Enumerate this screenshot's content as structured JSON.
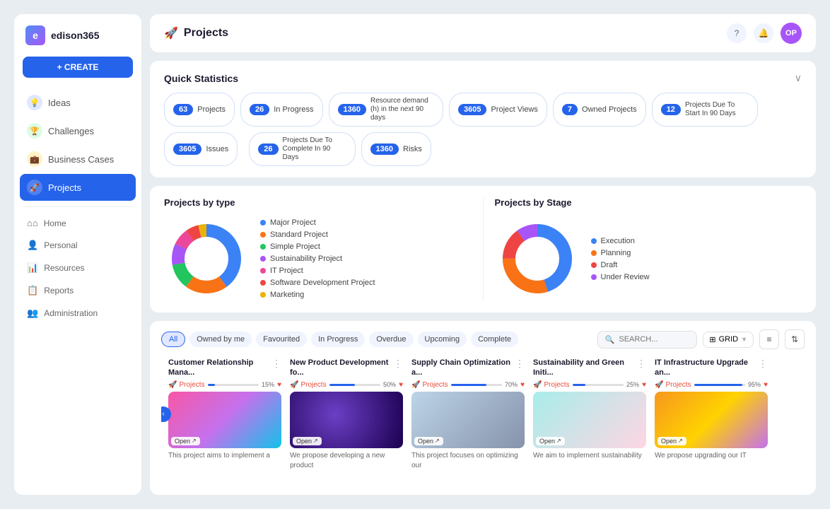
{
  "app": {
    "name": "edison365",
    "avatar": "OP"
  },
  "sidebar": {
    "create_label": "+ CREATE",
    "items": [
      {
        "id": "ideas",
        "label": "Ideas",
        "icon": "💡",
        "iconClass": "ideas",
        "active": false
      },
      {
        "id": "challenges",
        "label": "Challenges",
        "icon": "🏆",
        "iconClass": "challenges",
        "active": false
      },
      {
        "id": "business",
        "label": "Business Cases",
        "icon": "💼",
        "iconClass": "business",
        "active": false
      },
      {
        "id": "projects",
        "label": "Projects",
        "icon": "🚀",
        "iconClass": "projects",
        "active": true
      }
    ],
    "links": [
      {
        "id": "home",
        "label": "Home",
        "iconClass": "icon-home"
      },
      {
        "id": "personal",
        "label": "Personal",
        "iconClass": "icon-person"
      },
      {
        "id": "resources",
        "label": "Resources",
        "iconClass": "icon-resources"
      },
      {
        "id": "reports",
        "label": "Reports",
        "iconClass": "icon-reports"
      },
      {
        "id": "administration",
        "label": "Administration",
        "iconClass": "icon-admin"
      }
    ]
  },
  "header": {
    "page_icon": "🚀",
    "page_title": "Projects"
  },
  "stats": {
    "title": "Quick Statistics",
    "pills": [
      {
        "num": "63",
        "label": "Projects"
      },
      {
        "num": "26",
        "label": "In Progress"
      },
      {
        "num": "1360",
        "label": "Resource demand (h) in the next 90 days",
        "small": true
      },
      {
        "num": "3605",
        "label": "Project Views"
      },
      {
        "num": "7",
        "label": "Owned Projects"
      },
      {
        "num": "12",
        "label": "Projects Due To Start In 90 Days"
      },
      {
        "num": "3605",
        "label": "Issues"
      },
      {
        "num": "26",
        "label": "Projects Due To Complete In 90 Days"
      },
      {
        "num": "1360",
        "label": "Risks"
      }
    ]
  },
  "charts": {
    "by_type": {
      "title": "Projects by type",
      "legend": [
        {
          "label": "Major Project",
          "color": "#3b82f6"
        },
        {
          "label": "Standard Project",
          "color": "#f97316"
        },
        {
          "label": "Simple Project",
          "color": "#22c55e"
        },
        {
          "label": "Sustainability Project",
          "color": "#a855f7"
        },
        {
          "label": "IT Project",
          "color": "#ec4899"
        },
        {
          "label": "Software Development Project",
          "color": "#ef4444"
        },
        {
          "label": "Marketing",
          "color": "#eab308"
        }
      ],
      "segments": [
        {
          "color": "#3b82f6",
          "pct": 40
        },
        {
          "color": "#f97316",
          "pct": 20
        },
        {
          "color": "#22c55e",
          "pct": 12
        },
        {
          "color": "#a855f7",
          "pct": 10
        },
        {
          "color": "#ec4899",
          "pct": 8
        },
        {
          "color": "#ef4444",
          "pct": 6
        },
        {
          "color": "#eab308",
          "pct": 4
        }
      ]
    },
    "by_stage": {
      "title": "Projects by Stage",
      "legend": [
        {
          "label": "Execution",
          "color": "#3b82f6"
        },
        {
          "label": "Planning",
          "color": "#f97316"
        },
        {
          "label": "Draft",
          "color": "#ef4444"
        },
        {
          "label": "Under Review",
          "color": "#a855f7"
        }
      ],
      "segments": [
        {
          "color": "#3b82f6",
          "pct": 45
        },
        {
          "color": "#f97316",
          "pct": 30
        },
        {
          "color": "#ef4444",
          "pct": 15
        },
        {
          "color": "#a855f7",
          "pct": 10
        }
      ]
    }
  },
  "projects_toolbar": {
    "filters": [
      "All",
      "Owned by me",
      "Favourited",
      "In Progress",
      "Overdue",
      "Upcoming",
      "Complete"
    ],
    "active_filter": "All",
    "search_placeholder": "SEARCH...",
    "grid_label": "GRID"
  },
  "projects": [
    {
      "name": "Customer Relationship Mana...",
      "type": "Projects",
      "progress": 15,
      "desc": "This project aims to implement a",
      "thumb_class": "thumb-pink",
      "open_label": "Open"
    },
    {
      "name": "New Product Development fo...",
      "type": "Projects",
      "progress": 50,
      "desc": "We propose developing a new product",
      "thumb_class": "thumb-purple",
      "open_label": "Open"
    },
    {
      "name": "Supply Chain Optimization a...",
      "type": "Projects",
      "progress": 70,
      "desc": "This project focuses on optimizing our",
      "thumb_class": "thumb-desk",
      "open_label": "Open"
    },
    {
      "name": "Sustainability and Green Initi...",
      "type": "Projects",
      "progress": 25,
      "desc": "We aim to implement sustainability",
      "thumb_class": "thumb-green",
      "open_label": "Open"
    },
    {
      "name": "IT Infrastructure Upgrade an...",
      "type": "Projects",
      "progress": 95,
      "desc": "We propose upgrading our IT",
      "thumb_class": "thumb-yellow",
      "open_label": "Open"
    }
  ]
}
